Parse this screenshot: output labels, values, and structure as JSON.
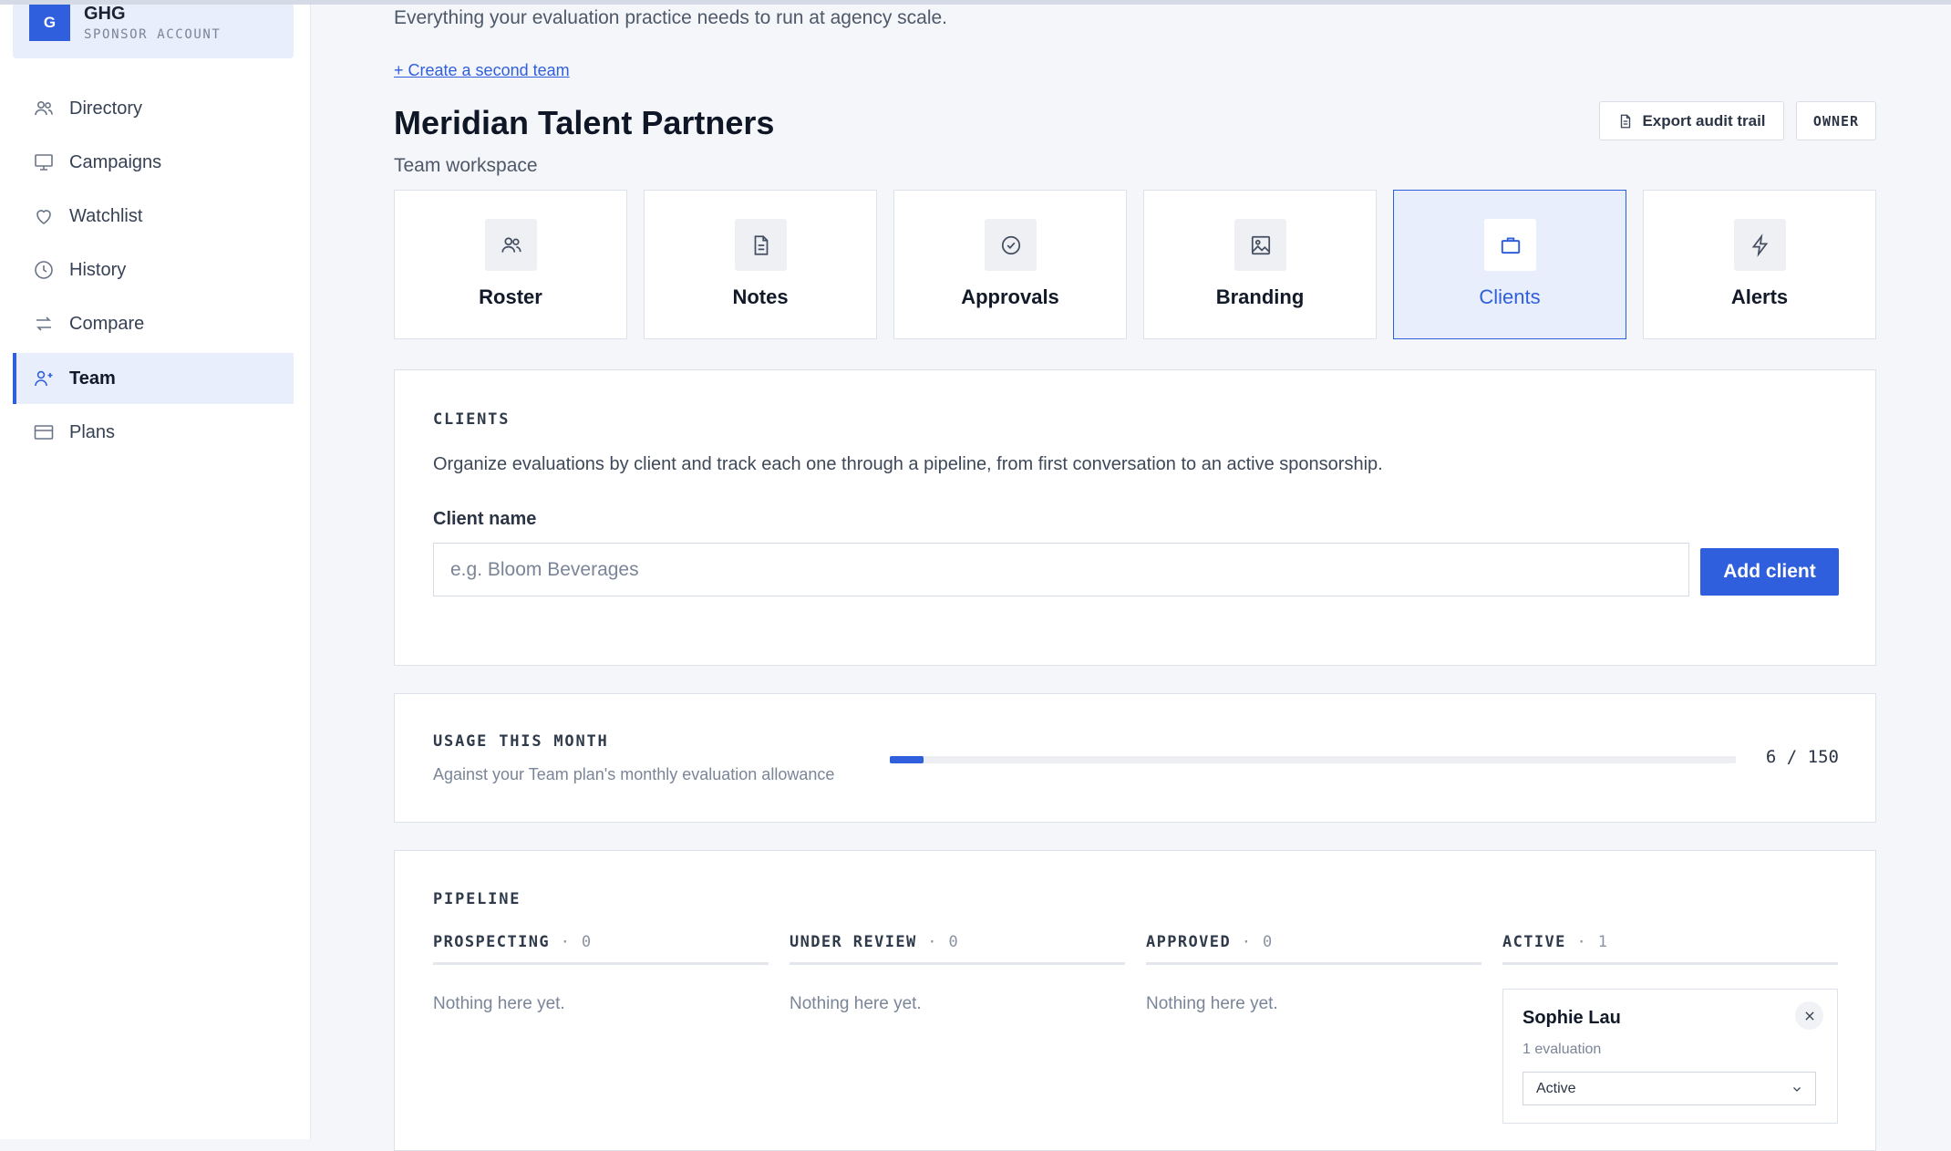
{
  "account": {
    "initial": "G",
    "name": "GHG",
    "type": "SPONSOR ACCOUNT"
  },
  "sidebar": {
    "items": [
      {
        "label": "Directory",
        "icon": "users-icon"
      },
      {
        "label": "Campaigns",
        "icon": "monitor-icon"
      },
      {
        "label": "Watchlist",
        "icon": "heart-icon"
      },
      {
        "label": "History",
        "icon": "clock-icon"
      },
      {
        "label": "Compare",
        "icon": "swap-arrows-icon"
      },
      {
        "label": "Team",
        "icon": "user-plus-icon",
        "active": true
      },
      {
        "label": "Plans",
        "icon": "credit-card-icon"
      }
    ]
  },
  "header": {
    "intro": "Everything your evaluation practice needs to run at agency scale.",
    "create_link": "+ Create a second team",
    "team_name": "Meridian Talent Partners",
    "team_sub": "Team workspace",
    "export_label": "Export audit trail",
    "role_badge": "OWNER"
  },
  "tiles": [
    {
      "label": "Roster",
      "icon": "users-icon"
    },
    {
      "label": "Notes",
      "icon": "document-icon"
    },
    {
      "label": "Approvals",
      "icon": "check-circle-icon"
    },
    {
      "label": "Branding",
      "icon": "image-icon"
    },
    {
      "label": "Clients",
      "icon": "briefcase-icon",
      "active": true
    },
    {
      "label": "Alerts",
      "icon": "lightning-icon"
    }
  ],
  "clients": {
    "section_label": "CLIENTS",
    "description": "Organize evaluations by client and track each one through a pipeline, from first conversation to an active sponsorship.",
    "field_label": "Client name",
    "placeholder": "e.g. Bloom Beverages",
    "add_button": "Add client"
  },
  "usage": {
    "section_label": "USAGE THIS MONTH",
    "subtitle": "Against your Team plan's monthly evaluation allowance",
    "used": 6,
    "limit": 150,
    "count_text": "6 / 150"
  },
  "pipeline": {
    "section_label": "PIPELINE",
    "separator": "·",
    "empty_text": "Nothing here yet.",
    "columns": [
      {
        "title": "PROSPECTING",
        "count": "0"
      },
      {
        "title": "UNDER REVIEW",
        "count": "0"
      },
      {
        "title": "APPROVED",
        "count": "0"
      },
      {
        "title": "ACTIVE",
        "count": "1"
      }
    ],
    "active_card": {
      "name": "Sophie Lau",
      "evaluations": "1 evaluation",
      "status": "Active"
    }
  },
  "colors": {
    "accent": "#2f5fdc",
    "page_bg": "#f4f6fa",
    "active_bg": "#e8eefb"
  }
}
